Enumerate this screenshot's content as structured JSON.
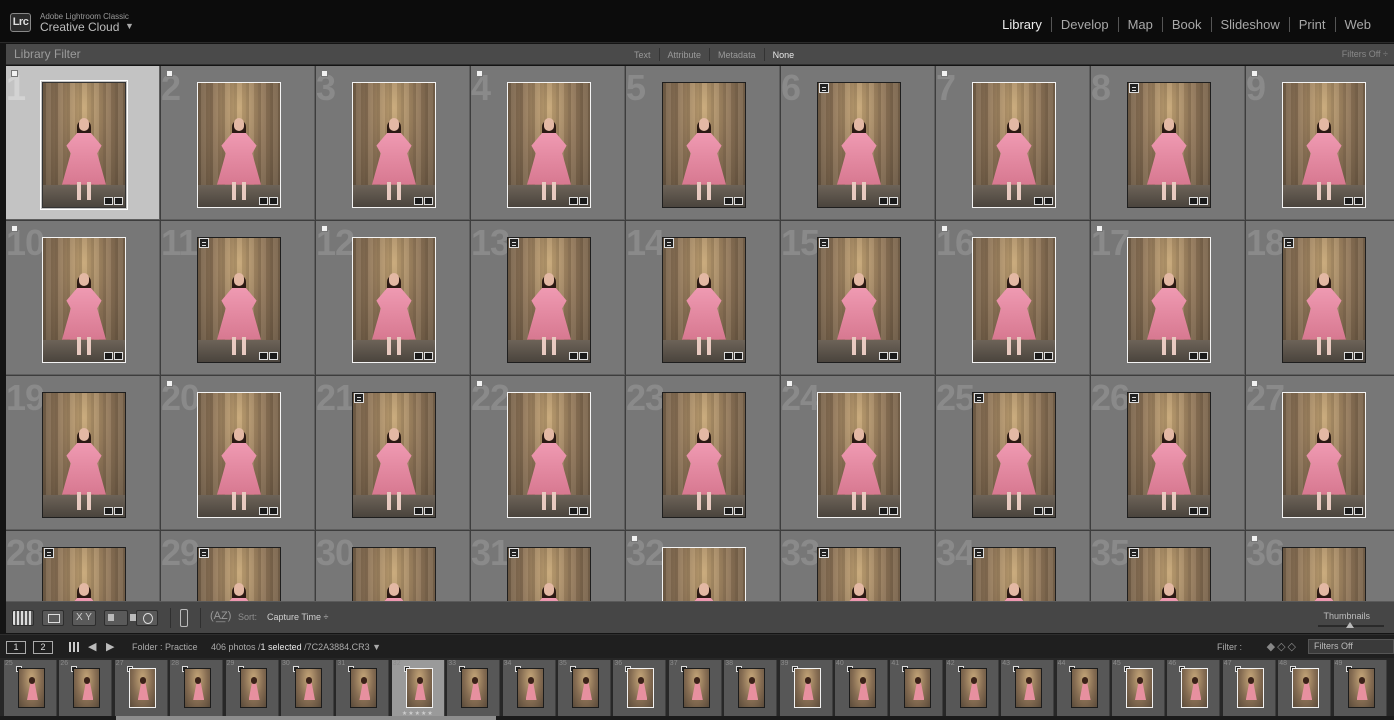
{
  "app": {
    "logo_text": "Lrc",
    "brand_small": "Adobe Lightroom Classic",
    "brand_big": "Creative Cloud",
    "brand_caret": "▼"
  },
  "modules": [
    "Library",
    "Develop",
    "Map",
    "Book",
    "Slideshow",
    "Print",
    "Web"
  ],
  "active_module": "Library",
  "library_filter": {
    "title": "Library Filter",
    "options": [
      "Text",
      "Attribute",
      "Metadata",
      "None"
    ],
    "active": "None",
    "filters_off": "Filters Off ÷"
  },
  "grid": {
    "cells": [
      {
        "n": "1",
        "flag": true,
        "copy": false,
        "white": false,
        "selected": true
      },
      {
        "n": "2",
        "flag": true,
        "copy": false,
        "white": true
      },
      {
        "n": "3",
        "flag": true,
        "copy": false,
        "white": true
      },
      {
        "n": "4",
        "flag": true,
        "copy": false,
        "white": true
      },
      {
        "n": "5",
        "flag": false,
        "copy": false,
        "white": false
      },
      {
        "n": "6",
        "flag": false,
        "copy": true,
        "white": false
      },
      {
        "n": "7",
        "flag": true,
        "copy": false,
        "white": true
      },
      {
        "n": "8",
        "flag": false,
        "copy": true,
        "white": false
      },
      {
        "n": "9",
        "flag": true,
        "copy": false,
        "white": true
      },
      {
        "n": "10",
        "flag": true,
        "copy": false,
        "white": true
      },
      {
        "n": "11",
        "flag": false,
        "copy": true,
        "white": false
      },
      {
        "n": "12",
        "flag": true,
        "copy": false,
        "white": true
      },
      {
        "n": "13",
        "flag": false,
        "copy": true,
        "white": false
      },
      {
        "n": "14",
        "flag": false,
        "copy": true,
        "white": false
      },
      {
        "n": "15",
        "flag": false,
        "copy": true,
        "white": false
      },
      {
        "n": "16",
        "flag": true,
        "copy": false,
        "white": true
      },
      {
        "n": "17",
        "flag": true,
        "copy": false,
        "white": true
      },
      {
        "n": "18",
        "flag": false,
        "copy": true,
        "white": false
      },
      {
        "n": "19",
        "flag": false,
        "copy": false,
        "white": false
      },
      {
        "n": "20",
        "flag": true,
        "copy": false,
        "white": true
      },
      {
        "n": "21",
        "flag": false,
        "copy": true,
        "white": false
      },
      {
        "n": "22",
        "flag": true,
        "copy": false,
        "white": true
      },
      {
        "n": "23",
        "flag": false,
        "copy": false,
        "white": false
      },
      {
        "n": "24",
        "flag": true,
        "copy": false,
        "white": true
      },
      {
        "n": "25",
        "flag": false,
        "copy": true,
        "white": false
      },
      {
        "n": "26",
        "flag": false,
        "copy": true,
        "white": false
      },
      {
        "n": "27",
        "flag": true,
        "copy": false,
        "white": true
      },
      {
        "n": "28",
        "flag": false,
        "copy": true,
        "white": false
      },
      {
        "n": "29",
        "flag": false,
        "copy": true,
        "white": false
      },
      {
        "n": "30",
        "flag": false,
        "copy": false,
        "white": false
      },
      {
        "n": "31",
        "flag": false,
        "copy": true,
        "white": false
      },
      {
        "n": "32",
        "flag": true,
        "copy": false,
        "white": true
      },
      {
        "n": "33",
        "flag": false,
        "copy": true,
        "white": false
      },
      {
        "n": "34",
        "flag": false,
        "copy": true,
        "white": false
      },
      {
        "n": "35",
        "flag": false,
        "copy": true,
        "white": false
      },
      {
        "n": "36",
        "flag": true,
        "copy": false,
        "white": false
      }
    ]
  },
  "toolbar": {
    "compare_label": "X Y",
    "sort_cycle": "(A͟Z)",
    "sort_label": "Sort:",
    "sort_value": "Capture Time ÷",
    "thumbnails_label": "Thumbnails"
  },
  "filmstrip_header": {
    "monitor1": "1",
    "monitor2": "2",
    "folder": "Folder : Practice",
    "count": "406 photos /",
    "selected": "1 selected",
    "file": "/7C2A3884.CR3 ▼",
    "filter_label": "Filter :",
    "diamonds": "◆◇◇",
    "filter_select": "Filters Off"
  },
  "filmstrip": {
    "items": [
      {
        "n": "25",
        "white": false
      },
      {
        "n": "26",
        "white": false
      },
      {
        "n": "27",
        "white": true
      },
      {
        "n": "28",
        "white": false
      },
      {
        "n": "29",
        "white": false
      },
      {
        "n": "30",
        "white": false
      },
      {
        "n": "31",
        "white": false
      },
      {
        "n": "32",
        "white": true,
        "sel": true,
        "dots": "★★★★★"
      },
      {
        "n": "33",
        "white": false
      },
      {
        "n": "34",
        "white": false
      },
      {
        "n": "35",
        "white": false
      },
      {
        "n": "36",
        "white": true
      },
      {
        "n": "37",
        "white": false
      },
      {
        "n": "38",
        "white": false
      },
      {
        "n": "39",
        "white": true
      },
      {
        "n": "40",
        "white": false
      },
      {
        "n": "41",
        "white": false
      },
      {
        "n": "42",
        "white": false
      },
      {
        "n": "43",
        "white": false
      },
      {
        "n": "44",
        "white": false
      },
      {
        "n": "45",
        "white": true
      },
      {
        "n": "46",
        "white": true
      },
      {
        "n": "47",
        "white": true
      },
      {
        "n": "48",
        "white": true
      },
      {
        "n": "49",
        "white": false
      }
    ]
  }
}
